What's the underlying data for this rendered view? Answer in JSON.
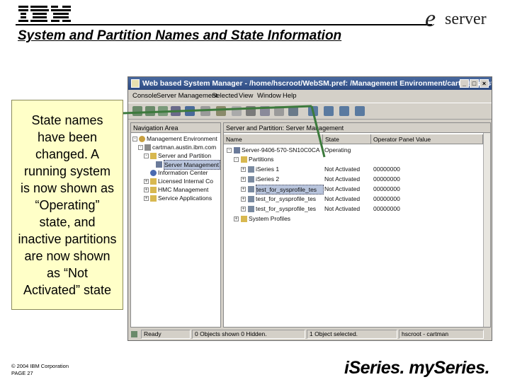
{
  "header": {
    "ibm_logo_text": "IBM",
    "title": "System and Partition Names and State Information",
    "eserver_e": "e",
    "eserver_text": "server"
  },
  "callout": {
    "text": "State names have been changed.  A running system is now shown as “Operating” state, and inactive partitions are now shown as “Not Activated” state"
  },
  "window": {
    "title": "Web based System Manager - /home/hscroot/WebSM.pref: /Management Environment/cartman.austi...",
    "menu": [
      "Console",
      "Server Management",
      "Selected",
      "View",
      "Window",
      "Help"
    ],
    "nav_header": "Navigation Area",
    "nav_tree": [
      "Management Environment",
      "cartman.austin.ibm.com",
      "Server and Partition",
      "Server Management",
      "Information Center",
      "Licensed Internal Co",
      "HMC Management",
      "Service Applications"
    ],
    "content_header": "Server and Partition: Server Management",
    "columns": [
      "Name",
      "State",
      "Operator Panel Value"
    ],
    "rows": [
      {
        "name": "Server-9406-570-SN10C0CA",
        "state": "Operating",
        "panel": ""
      },
      {
        "name": "Partitions",
        "state": "",
        "panel": ""
      },
      {
        "name": "iSeries 1",
        "state": "Not Activated",
        "panel": "00000000"
      },
      {
        "name": "iSeries 2",
        "state": "Not Activated",
        "panel": "00000000"
      },
      {
        "name": "test_for_sysprofile_tes",
        "state": "Not Activated",
        "panel": "00000000"
      },
      {
        "name": "test_for_sysprofile_tes",
        "state": "Not Activated",
        "panel": "00000000"
      },
      {
        "name": "test_for_sysprofile_tes",
        "state": "Not Activated",
        "panel": "00000000"
      },
      {
        "name": "System Profiles",
        "state": "",
        "panel": ""
      }
    ],
    "status": [
      "Ready",
      "0 Objects shown 0 Hidden.",
      "1 Object selected.",
      "hscroot - cartman"
    ]
  },
  "footer": {
    "copyright_line1": "© 2004 IBM Corporation",
    "copyright_line2": "PAGE 27",
    "brand": "iSeries. mySeries."
  },
  "colors": {
    "callout_bg": "#ffffc8",
    "pointer_green": "#3c7a3c",
    "titlebar_blue": "#2c4a82"
  }
}
